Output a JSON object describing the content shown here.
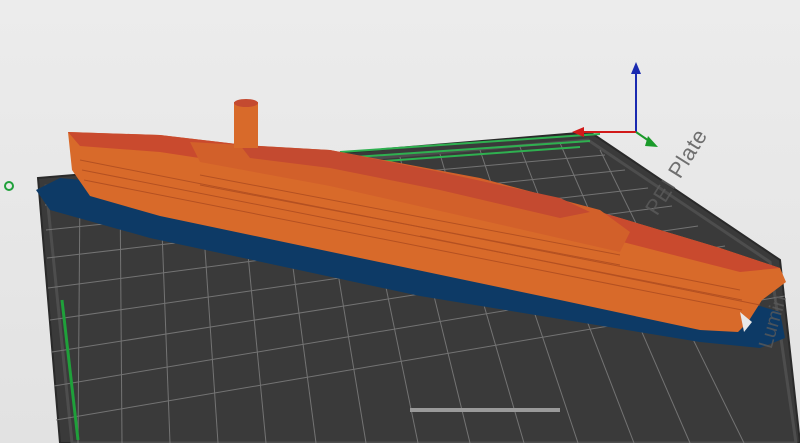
{
  "scene": {
    "plate_label": "PEI Plate",
    "vendor_label": "Lumin",
    "colors": {
      "background": "#e6e6e6",
      "bed": "#3a3a3a",
      "bed_edge": "#2a2a2a",
      "grid": "#7a7a7a",
      "ship_hull": "#d86a2a",
      "ship_deck": "#c94a2e",
      "skirt": "#0d3a66",
      "axis_x": "#d11a1a",
      "axis_y": "#1a9a2a",
      "axis_z": "#1a2ab0"
    },
    "icons": [
      "origin-marker-icon",
      "axis-gizmo-icon"
    ]
  }
}
